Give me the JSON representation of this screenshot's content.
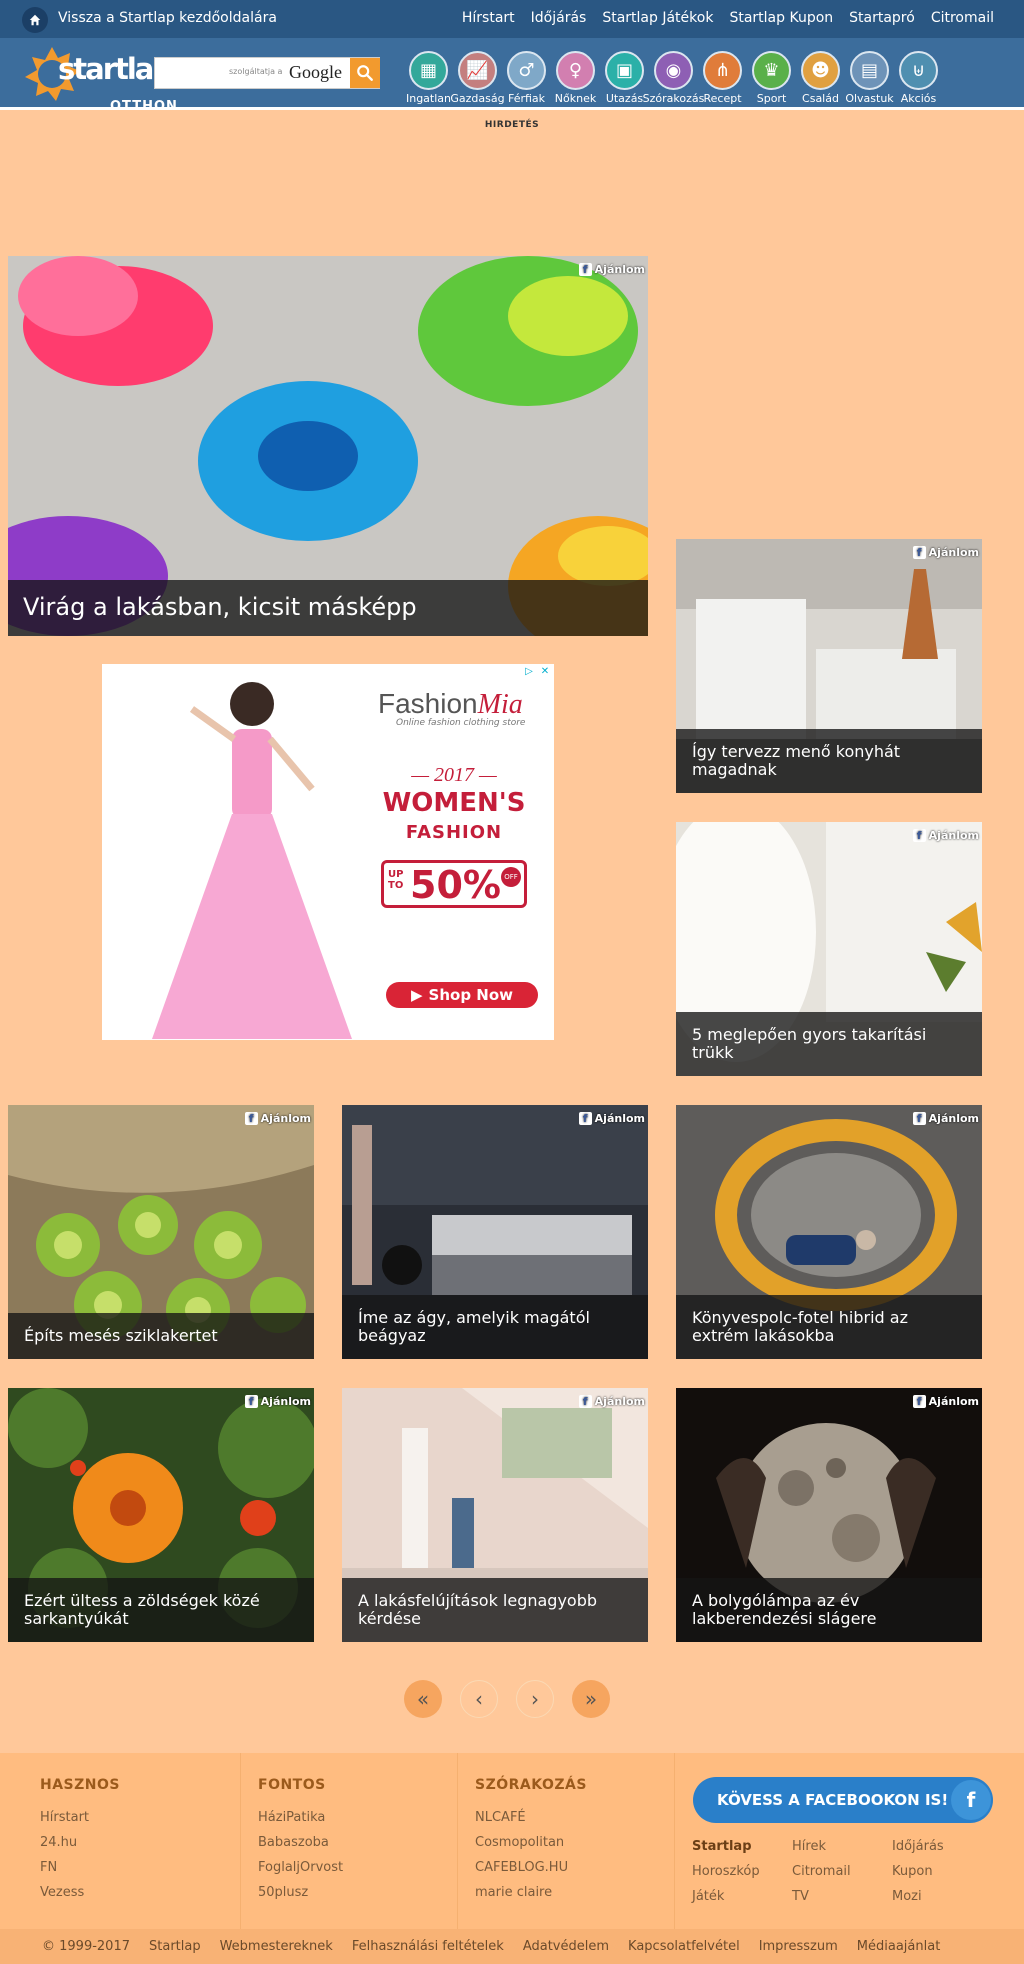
{
  "topbar": {
    "back_link": "Vissza a Startlap kezdőoldalára",
    "links": [
      "Hírstart",
      "Időjárás",
      "Startlap Játékok",
      "Startlap Kupon",
      "Startapró",
      "Citromail"
    ]
  },
  "header": {
    "logo_text": "startlap",
    "logo_sub": "OTTHON",
    "search_hint": "szolgáltatja a",
    "search_brand": "Google",
    "categories": [
      {
        "label": "Ingatlan",
        "icon": "building-icon",
        "color": "#33a89a"
      },
      {
        "label": "Gazdaság",
        "icon": "chart-icon",
        "color": "#c47f7f"
      },
      {
        "label": "Férfiak",
        "icon": "male-icon",
        "color": "#7fa8c8"
      },
      {
        "label": "Nőknek",
        "icon": "female-icon",
        "color": "#d27fb0"
      },
      {
        "label": "Utazás",
        "icon": "suitcase-icon",
        "color": "#2bb0a8"
      },
      {
        "label": "Szórakozás",
        "icon": "gamepad-icon",
        "color": "#8e5fb4"
      },
      {
        "label": "Recept",
        "icon": "cutlery-icon",
        "color": "#e07c3a"
      },
      {
        "label": "Sport",
        "icon": "trophy-icon",
        "color": "#5ab04a"
      },
      {
        "label": "Család",
        "icon": "family-icon",
        "color": "#e0a040"
      },
      {
        "label": "Olvastuk",
        "icon": "newspaper-icon",
        "color": "#6e93b8"
      },
      {
        "label": "Akciós",
        "icon": "basket-icon",
        "color": "#4f8fb0"
      }
    ]
  },
  "ad_label": "HIRDETÉS",
  "recommend_label": "Ajánlom",
  "articles": {
    "hero": "Virág a lakásban, kicsit másképp",
    "kitchen": "Így tervezz menő konyhát magadnak",
    "cleaning": "5 meglepően gyors takarítási trükk",
    "rockgarden": "Építs mesés sziklakertet",
    "bed": "Íme az ágy, amelyik magától beágyaz",
    "bookshelf": "Könyvespolc-fotel hibrid az extrém lakásokba",
    "nasturtium": "Ezért ültess a zöldségek közé sarkantyúkát",
    "renovation": "A lakásfelújítások legnagyobb kérdése",
    "moonlamp": "A bolygólámpa az év lakberendezési slágere"
  },
  "ad": {
    "brand": "Fashion",
    "brand_script": "Mia",
    "tagline": "Online fashion clothing store",
    "year": "— 2017 —",
    "headline1": "WOMEN'S",
    "headline2": "FASHION",
    "upto": "UP TO",
    "percent": "50%",
    "off": "OFF",
    "cta": "Shop Now"
  },
  "pager": [
    "«",
    "‹",
    "›",
    "»"
  ],
  "footer": {
    "col1": {
      "title": "HASZNOS",
      "links": [
        "Hírstart",
        "24.hu",
        "FN",
        "Vezess"
      ]
    },
    "col2": {
      "title": "FONTOS",
      "links": [
        "HáziPatika",
        "Babaszoba",
        "FoglaljOrvost",
        "50plusz"
      ]
    },
    "col3": {
      "title": "SZÓRAKOZÁS",
      "links": [
        "NLCAFÉ",
        "Cosmopolitan",
        "CAFEBLOG.HU",
        "marie claire"
      ]
    },
    "facebook": "KÖVESS A FACEBOOKON IS!",
    "grid": [
      "Startlap",
      "Hírek",
      "Időjárás",
      "Horoszkóp",
      "Citromail",
      "Kupon",
      "Játék",
      "TV",
      "Mozi"
    ]
  },
  "bottombar": [
    "© 1999-2017",
    "Startlap",
    "Webmestereknek",
    "Felhasználási feltételek",
    "Adatvédelem",
    "Kapcsolatfelvétel",
    "Impresszum",
    "Médiaajánlat"
  ]
}
